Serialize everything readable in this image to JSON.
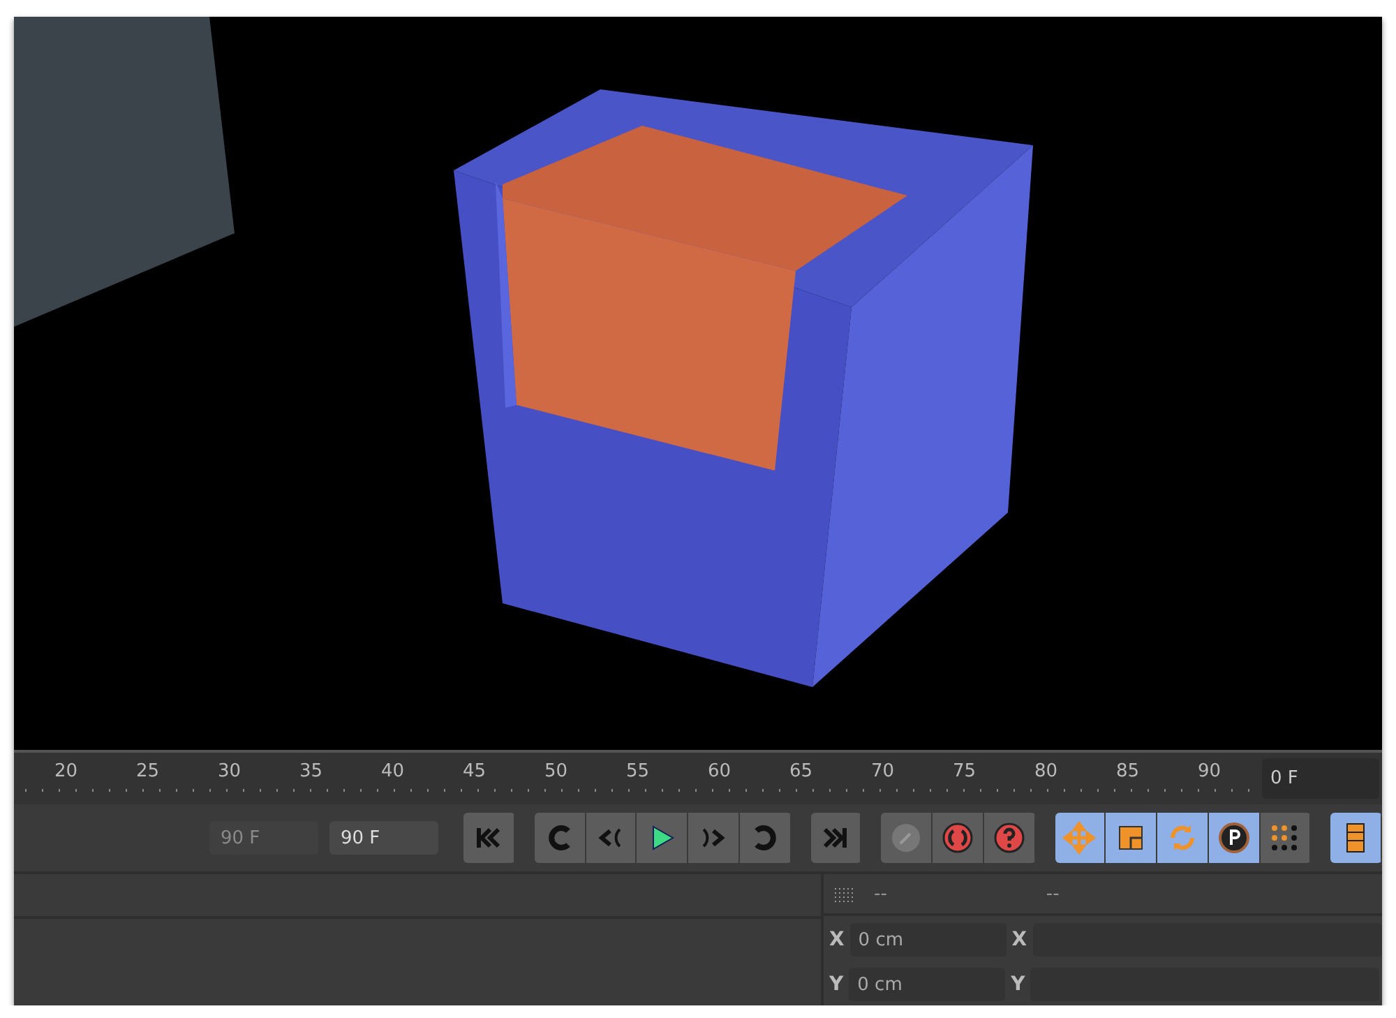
{
  "timeline": {
    "ticks": [
      "20",
      "25",
      "30",
      "35",
      "40",
      "45",
      "50",
      "55",
      "60",
      "65",
      "70",
      "75",
      "80",
      "85",
      "90"
    ],
    "current_frame": "0 F"
  },
  "transport": {
    "fields": [
      {
        "value": "90 F",
        "disabled": true
      },
      {
        "value": "90 F",
        "disabled": false
      }
    ],
    "button_groups": [
      [
        {
          "kind": "go-start",
          "on": false
        }
      ],
      [
        {
          "kind": "prev-key",
          "on": false
        },
        {
          "kind": "prev-frame",
          "on": false
        },
        {
          "kind": "play",
          "on": false
        },
        {
          "kind": "next-frame",
          "on": false
        },
        {
          "kind": "next-key",
          "on": false
        }
      ],
      [
        {
          "kind": "go-end",
          "on": false
        }
      ],
      [
        {
          "kind": "key",
          "on": false
        },
        {
          "kind": "autokey",
          "on": false
        },
        {
          "kind": "help",
          "on": false
        }
      ],
      [
        {
          "kind": "move",
          "on": true
        },
        {
          "kind": "scale",
          "on": true
        },
        {
          "kind": "rotate",
          "on": true
        },
        {
          "kind": "param",
          "on": true
        },
        {
          "kind": "point-grid",
          "on": false
        }
      ],
      [
        {
          "kind": "film",
          "on": true
        }
      ]
    ]
  },
  "coordinates": {
    "header": [
      "--",
      "--"
    ],
    "rows": [
      {
        "axis": "X",
        "value": "0 cm",
        "axis_2": "X"
      },
      {
        "axis": "Y",
        "value": "0 cm",
        "axis_2": "Y"
      }
    ]
  }
}
